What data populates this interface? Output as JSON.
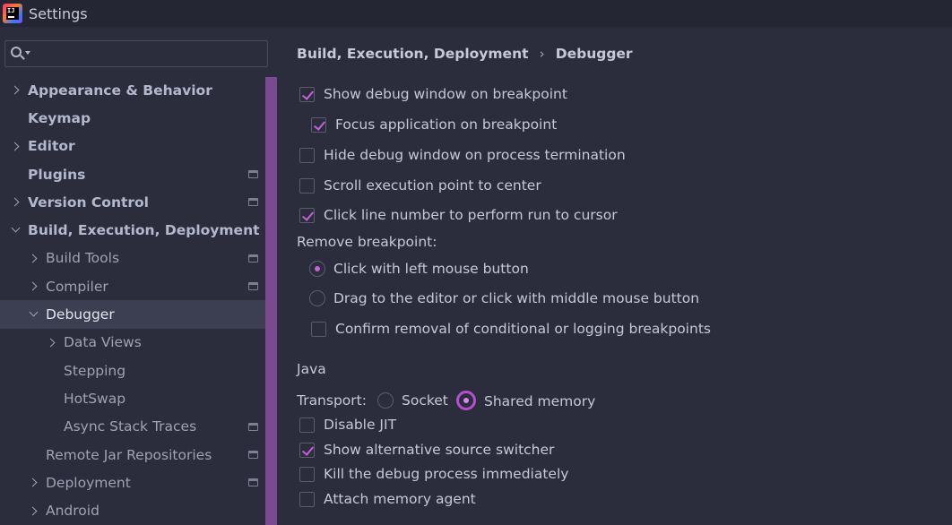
{
  "window": {
    "title": "Settings",
    "logo_text": "IJ"
  },
  "search": {
    "value": "",
    "placeholder": ""
  },
  "tree": [
    {
      "label": "Appearance & Behavior",
      "expander": "right",
      "level": 0,
      "bold": true,
      "page_icon": false
    },
    {
      "label": "Keymap",
      "expander": "none",
      "level": 0,
      "bold": true,
      "page_icon": false
    },
    {
      "label": "Editor",
      "expander": "right",
      "level": 0,
      "bold": true,
      "page_icon": false
    },
    {
      "label": "Plugins",
      "expander": "none",
      "level": 0,
      "bold": true,
      "page_icon": true
    },
    {
      "label": "Version Control",
      "expander": "right",
      "level": 0,
      "bold": true,
      "page_icon": true
    },
    {
      "label": "Build, Execution, Deployment",
      "expander": "down",
      "level": 0,
      "bold": true,
      "page_icon": false
    },
    {
      "label": "Build Tools",
      "expander": "right",
      "level": 1,
      "bold": false,
      "page_icon": true
    },
    {
      "label": "Compiler",
      "expander": "right",
      "level": 1,
      "bold": false,
      "page_icon": true
    },
    {
      "label": "Debugger",
      "expander": "down",
      "level": 1,
      "bold": false,
      "page_icon": false,
      "selected": true
    },
    {
      "label": "Data Views",
      "expander": "right",
      "level": 2,
      "bold": false,
      "page_icon": false
    },
    {
      "label": "Stepping",
      "expander": "none",
      "level": 2,
      "bold": false,
      "page_icon": false
    },
    {
      "label": "HotSwap",
      "expander": "none",
      "level": 2,
      "bold": false,
      "page_icon": false
    },
    {
      "label": "Async Stack Traces",
      "expander": "none",
      "level": 2,
      "bold": false,
      "page_icon": true
    },
    {
      "label": "Remote Jar Repositories",
      "expander": "none",
      "level": 1,
      "bold": false,
      "page_icon": true
    },
    {
      "label": "Deployment",
      "expander": "right",
      "level": 1,
      "bold": false,
      "page_icon": true
    },
    {
      "label": "Android",
      "expander": "right",
      "level": 1,
      "bold": false,
      "page_icon": false
    }
  ],
  "breadcrumb": {
    "parent": "Build, Execution, Deployment",
    "separator": "›",
    "current": "Debugger"
  },
  "options": {
    "show_debug_window": {
      "label": "Show debug window on breakpoint",
      "checked": true
    },
    "focus_application": {
      "label": "Focus application on breakpoint",
      "checked": true
    },
    "hide_debug_window": {
      "label": "Hide debug window on process termination",
      "checked": false
    },
    "scroll_execution": {
      "label": "Scroll execution point to center",
      "checked": false
    },
    "click_line_number": {
      "label": "Click line number to perform run to cursor",
      "checked": true
    }
  },
  "remove_breakpoint": {
    "label": "Remove breakpoint:",
    "click_left": {
      "label": "Click with left mouse button",
      "selected": true
    },
    "drag_middle": {
      "label": "Drag to the editor or click with middle mouse button",
      "selected": false
    },
    "confirm_removal": {
      "label": "Confirm removal of conditional or logging breakpoints",
      "checked": false
    }
  },
  "java": {
    "heading": "Java",
    "transport_label": "Transport:",
    "socket": {
      "label": "Socket",
      "selected": false
    },
    "shared_memory": {
      "label": "Shared memory",
      "selected": true
    },
    "disable_jit": {
      "label": "Disable JIT",
      "checked": false
    },
    "show_alt_source": {
      "label": "Show alternative source switcher",
      "checked": true
    },
    "kill_debug": {
      "label": "Kill the debug process immediately",
      "checked": false
    },
    "attach_memory": {
      "label": "Attach memory agent",
      "checked": false
    }
  },
  "colors": {
    "background": "#2b2d3d",
    "titlebar": "#252633",
    "selection": "#3c3f52",
    "accent": "#c561d9",
    "accent_strip": "#7a4a8f"
  }
}
